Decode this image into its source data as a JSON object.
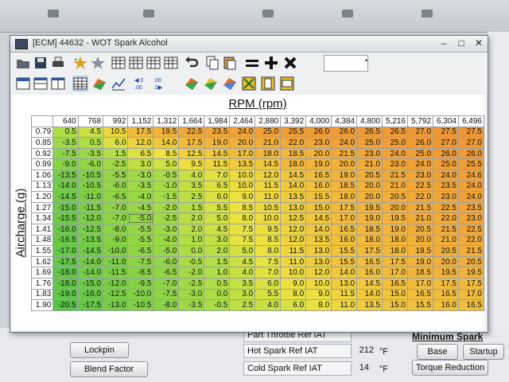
{
  "window": {
    "title": "[ECM] 44632 - WOT Spark Alcohol",
    "min": "–",
    "max": "□",
    "close": "✕"
  },
  "search": {
    "value": ""
  },
  "map": {
    "x_axis_label": "RPM (rpm)",
    "y_axis_label": "Aircharge (g)",
    "rpm": [
      "640",
      "768",
      "992",
      "1,152",
      "1,312",
      "1,664",
      "1,984",
      "2,464",
      "2,880",
      "3,392",
      "4,000",
      "4,384",
      "4,800",
      "5,216",
      "5,792",
      "6,304",
      "6,496"
    ],
    "aircharge": [
      "0.79",
      "0.85",
      "0.92",
      "0.99",
      "1.06",
      "1.13",
      "1.20",
      "1.27",
      "1.34",
      "1.41",
      "1.48",
      "1.55",
      "1.62",
      "1.69",
      "1.76",
      "1.83",
      "1.90"
    ],
    "values": [
      [
        "0.5",
        "4.5",
        "10.5",
        "17.5",
        "19.5",
        "22.5",
        "23.5",
        "24.0",
        "25.0",
        "25.5",
        "26.0",
        "26.0",
        "26.5",
        "26.5",
        "27.0",
        "27.5",
        "27.5"
      ],
      [
        "-3.5",
        "0.5",
        "6.0",
        "12.0",
        "14.0",
        "17.5",
        "19.0",
        "20.0",
        "21.0",
        "22.0",
        "23.0",
        "24.0",
        "25.0",
        "25.0",
        "26.0",
        "27.0",
        "27.0"
      ],
      [
        "-7.5",
        "-3.5",
        "1.5",
        "6.5",
        "8.5",
        "12.5",
        "14.5",
        "17.0",
        "18.0",
        "18.5",
        "20.0",
        "21.5",
        "23.0",
        "24.0",
        "25.0",
        "26.0",
        "26.0"
      ],
      [
        "-9.0",
        "-6.0",
        "-2.5",
        "3.0",
        "5.0",
        "9.5",
        "11.5",
        "13.5",
        "14.5",
        "18.0",
        "19.0",
        "20.0",
        "21.0",
        "23.0",
        "24.0",
        "25.0",
        "25.5"
      ],
      [
        "-13.5",
        "-10.5",
        "-5.5",
        "-3.0",
        "-0.5",
        "4.0",
        "7.0",
        "10.0",
        "12.0",
        "14.5",
        "16.5",
        "19.0",
        "20.5",
        "21.5",
        "23.0",
        "24.0",
        "24.6"
      ],
      [
        "-14.0",
        "-10.5",
        "-6.0",
        "-3.5",
        "-1.0",
        "3.5",
        "6.5",
        "10.0",
        "11.5",
        "14.0",
        "16.0",
        "18.5",
        "20.0",
        "21.0",
        "22.5",
        "23.5",
        "24.0"
      ],
      [
        "-14.5",
        "-11.0",
        "-6.5",
        "-4.0",
        "-1.5",
        "2.5",
        "6.0",
        "9.0",
        "11.0",
        "13.5",
        "15.5",
        "18.0",
        "20.0",
        "20.5",
        "22.0",
        "23.0",
        "24.0"
      ],
      [
        "-15.0",
        "-11.5",
        "-7.0",
        "-4.5",
        "-2.0",
        "1.5",
        "5.5",
        "8.5",
        "10.5",
        "13.0",
        "15.0",
        "17.5",
        "19.5",
        "20.0",
        "21.5",
        "22.5",
        "23.5"
      ],
      [
        "-15.5",
        "-12.0",
        "-7.0",
        "-5.0",
        "-2.5",
        "2.0",
        "5.0",
        "8.0",
        "10.0",
        "12.5",
        "14.5",
        "17.0",
        "19.0",
        "19.5",
        "21.0",
        "22.0",
        "23.0"
      ],
      [
        "-16.0",
        "-12.5",
        "-8.0",
        "-5.5",
        "-3.0",
        "2.0",
        "4.5",
        "7.5",
        "9.5",
        "12.0",
        "14.0",
        "16.5",
        "18.5",
        "19.0",
        "20.5",
        "21.5",
        "22.5"
      ],
      [
        "-16.5",
        "-13.5",
        "-9.0",
        "-5.5",
        "-4.0",
        "1.0",
        "3.0",
        "7.5",
        "8.5",
        "12.0",
        "13.5",
        "16.0",
        "18.0",
        "18.0",
        "20.0",
        "21.0",
        "22.0"
      ],
      [
        "-17.0",
        "-14.5",
        "-10.0",
        "-6.5",
        "-5.0",
        "0.0",
        "2.0",
        "5.0",
        "8.0",
        "11.5",
        "13.0",
        "15.5",
        "17.5",
        "18.0",
        "19.5",
        "20.5",
        "21.5"
      ],
      [
        "-17.5",
        "-14.0",
        "-11.0",
        "-7.5",
        "-6.0",
        "-0.5",
        "1.5",
        "4.5",
        "7.5",
        "11.0",
        "13.0",
        "15.5",
        "16.5",
        "17.5",
        "19.0",
        "20.0",
        "20.5"
      ],
      [
        "-18.0",
        "-14.0",
        "-11.5",
        "-8.5",
        "-6.5",
        "-2.0",
        "1.0",
        "4.0",
        "7.0",
        "10.0",
        "12.0",
        "14.0",
        "16.0",
        "17.0",
        "18.5",
        "19.5",
        "19.5"
      ],
      [
        "-18.0",
        "-15.0",
        "-12.0",
        "-9.5",
        "-7.0",
        "-2.5",
        "0.5",
        "3.5",
        "6.0",
        "9.0",
        "10.0",
        "13.0",
        "14.5",
        "16.5",
        "17.0",
        "17.5",
        "17.5"
      ],
      [
        "-19.0",
        "-16.0",
        "-12.5",
        "-10.0",
        "-7.5",
        "-3.0",
        "0.0",
        "3.0",
        "5.5",
        "8.0",
        "9.0",
        "11.5",
        "14.0",
        "15.0",
        "16.5",
        "16.5",
        "17.0"
      ],
      [
        "-20.5",
        "-17.5",
        "-13.0",
        "-10.5",
        "-8.0",
        "-3.5",
        "-0.5",
        "2.5",
        "4.0",
        "6.0",
        "8.0",
        "11.0",
        "13.5",
        "15.0",
        "15.5",
        "16.0",
        "16.5"
      ]
    ]
  },
  "bottom_panel": {
    "lockpin": "Lockpin",
    "blend_factor": "Blend Factor",
    "part_throttle_ref_iat": "Part Throttle Ref IAT",
    "hot_spark_ref_iat": "Hot Spark Ref IAT",
    "hot_spark_value": "212",
    "cold_spark_ref_iat": "Cold Spark Ref IAT",
    "cold_spark_value": "14",
    "unit_f": "°F",
    "minimum_spark": "Minimum Spark",
    "base": "Base",
    "startup": "Startup",
    "torque_reduction": "Torque Reduction"
  },
  "colors": {
    "cold": "#5cc84a",
    "mid": "#e8e040",
    "hot": "#f2a035",
    "title_bar": "#dfe3e7"
  }
}
